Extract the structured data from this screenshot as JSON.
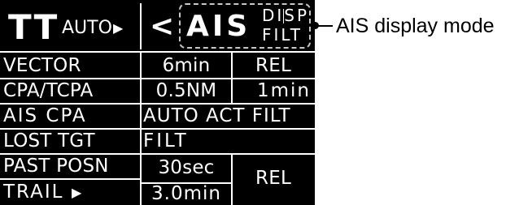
{
  "header": {
    "tt_label": "TT",
    "auto_label": "AUTO",
    "expand_arrow": "▶",
    "back_arrow": "<",
    "ais_label": "AIS",
    "disp_label": "DISP",
    "filt_label": "FILT"
  },
  "callout": {
    "label": "AIS display mode"
  },
  "rows": [
    {
      "label": "VECTOR",
      "value1": "6min",
      "value2": "REL"
    },
    {
      "label": "CPA/TCPA",
      "value1": "0.5NM",
      "value2": "1min"
    },
    {
      "label": "AIS CPA",
      "value": "AUTO ACT FILT"
    },
    {
      "label": "LOST TGT",
      "value": "FILT"
    },
    {
      "label": "PAST POSN",
      "value1": "30sec",
      "value2": "REL"
    },
    {
      "label": "TRAIL",
      "value1": "3.0min",
      "arrow": "▶"
    }
  ],
  "colors": {
    "panel_bg": "#000000",
    "text": "#ffffff",
    "label_bg_highlight": "#202020",
    "border": "#ffffff",
    "dash_box": "#c8c8c8"
  }
}
